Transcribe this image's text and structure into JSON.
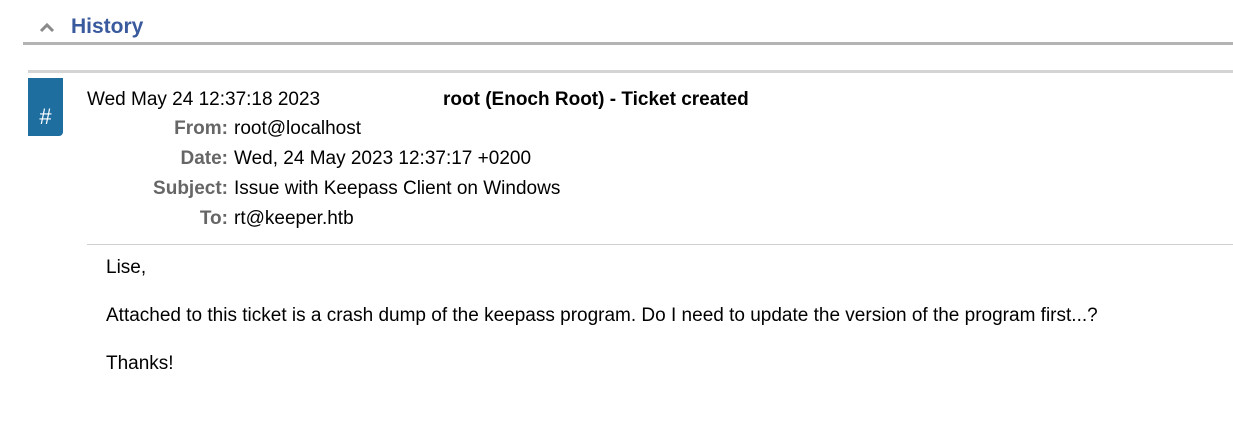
{
  "history": {
    "title": "History",
    "collapse_icon": "chevron-up-icon"
  },
  "transaction": {
    "marker": "#",
    "date": "Wed May 24 12:37:18 2023",
    "description": "root (Enoch Root) - Ticket created",
    "headers": [
      {
        "label": "From:",
        "value": "root@localhost"
      },
      {
        "label": "Date:",
        "value": "Wed, 24 May 2023 12:37:17 +0200"
      },
      {
        "label": "Subject:",
        "value": "Issue with Keepass Client on Windows"
      },
      {
        "label": "To:",
        "value": "rt@keeper.htb"
      }
    ],
    "body": [
      "Lise,",
      "Attached to this ticket is a crash dump of the keepass program. Do I need to update the version of the program first...?",
      "Thanks!"
    ]
  },
  "colors": {
    "title": "#3a5a9e",
    "marker_bg": "#1f6ea0",
    "header_label": "#666666"
  }
}
